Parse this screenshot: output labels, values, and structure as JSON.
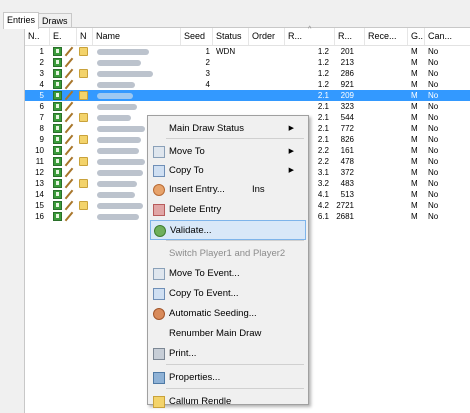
{
  "tabs": [
    "Entries",
    "Draws"
  ],
  "columns": [
    "N..",
    "E.",
    "N",
    "Name",
    "Seed",
    "Status",
    "Order",
    "R...",
    "R...",
    "Rece...",
    "G..",
    "Can..."
  ],
  "rows": [
    {
      "n": "1",
      "seed": "1",
      "status": "WDN",
      "r1": "1.2",
      "r2": "201",
      "g": "M",
      "can": "No"
    },
    {
      "n": "2",
      "seed": "2",
      "status": "",
      "r1": "1.2",
      "r2": "213",
      "g": "M",
      "can": "No"
    },
    {
      "n": "3",
      "seed": "3",
      "status": "",
      "r1": "1.2",
      "r2": "286",
      "g": "M",
      "can": "No"
    },
    {
      "n": "4",
      "seed": "4",
      "status": "",
      "r1": "1.2",
      "r2": "921",
      "g": "M",
      "can": "No"
    },
    {
      "n": "5",
      "seed": "",
      "status": "",
      "r1": "2.1",
      "r2": "209",
      "g": "M",
      "can": "No"
    },
    {
      "n": "6",
      "seed": "",
      "status": "",
      "r1": "2.1",
      "r2": "323",
      "g": "M",
      "can": "No"
    },
    {
      "n": "7",
      "seed": "",
      "status": "",
      "r1": "2.1",
      "r2": "544",
      "g": "M",
      "can": "No"
    },
    {
      "n": "8",
      "seed": "",
      "status": "",
      "r1": "2.1",
      "r2": "772",
      "g": "M",
      "can": "No"
    },
    {
      "n": "9",
      "seed": "",
      "status": "",
      "r1": "2.1",
      "r2": "826",
      "g": "M",
      "can": "No"
    },
    {
      "n": "10",
      "seed": "",
      "status": "",
      "r1": "2.2",
      "r2": "161",
      "g": "M",
      "can": "No"
    },
    {
      "n": "11",
      "seed": "",
      "status": "",
      "r1": "2.2",
      "r2": "478",
      "g": "M",
      "can": "No"
    },
    {
      "n": "12",
      "seed": "",
      "status": "",
      "r1": "3.1",
      "r2": "372",
      "g": "M",
      "can": "No"
    },
    {
      "n": "13",
      "seed": "",
      "status": "",
      "r1": "3.2",
      "r2": "483",
      "g": "M",
      "can": "No"
    },
    {
      "n": "14",
      "seed": "",
      "status": "",
      "r1": "4.1",
      "r2": "513",
      "g": "M",
      "can": "No"
    },
    {
      "n": "15",
      "seed": "",
      "status": "",
      "r1": "4.2",
      "r2": "2721",
      "g": "M",
      "can": "No"
    },
    {
      "n": "16",
      "seed": "",
      "status": "",
      "r1": "6.1",
      "r2": "2681",
      "g": "M",
      "can": "No"
    }
  ],
  "menu": {
    "items": [
      {
        "label": "Main Draw Status",
        "shortcut": "",
        "submenu": true,
        "icon": "",
        "state": "normal"
      },
      {
        "label": "Move To",
        "shortcut": "",
        "submenu": true,
        "icon": "move-icon",
        "state": "normal"
      },
      {
        "label": "Copy To",
        "shortcut": "",
        "submenu": true,
        "icon": "copy-icon",
        "state": "normal"
      },
      {
        "label": "Insert Entry...",
        "shortcut": "Ins",
        "submenu": false,
        "icon": "insert-person-icon",
        "state": "normal"
      },
      {
        "label": "Delete Entry",
        "shortcut": "",
        "submenu": false,
        "icon": "delete-icon",
        "state": "normal"
      },
      {
        "label": "Validate...",
        "shortcut": "",
        "submenu": false,
        "icon": "validate-icon",
        "state": "highlighted"
      },
      {
        "label": "Switch Player1 and Player2",
        "shortcut": "",
        "submenu": false,
        "icon": "",
        "state": "disabled"
      },
      {
        "label": "Move To Event...",
        "shortcut": "",
        "submenu": false,
        "icon": "move-event-icon",
        "state": "normal"
      },
      {
        "label": "Copy To Event...",
        "shortcut": "",
        "submenu": false,
        "icon": "copy-event-icon",
        "state": "normal"
      },
      {
        "label": "Automatic Seeding...",
        "shortcut": "",
        "submenu": false,
        "icon": "seeding-icon",
        "state": "normal"
      },
      {
        "label": "Renumber Main Draw",
        "shortcut": "",
        "submenu": false,
        "icon": "",
        "state": "normal"
      },
      {
        "label": "Print...",
        "shortcut": "",
        "submenu": false,
        "icon": "print-icon",
        "state": "normal"
      },
      {
        "label": "Properties...",
        "shortcut": "",
        "submenu": false,
        "icon": "properties-icon",
        "state": "normal"
      },
      {
        "label": "Callum Rendle",
        "shortcut": "",
        "submenu": false,
        "icon": "folder-icon",
        "state": "normal"
      }
    ]
  },
  "colors": {
    "selection": "#3399ff",
    "menu_highlight": "#d9e8f8",
    "disabled_text": "#8c8c8c"
  }
}
